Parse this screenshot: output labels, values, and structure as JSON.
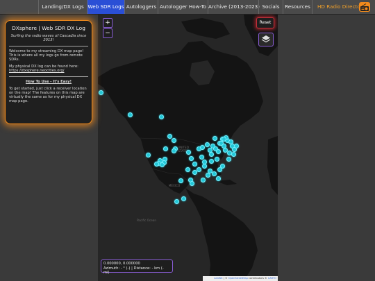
{
  "nav": {
    "items": [
      {
        "label": "Landing/DX Logs"
      },
      {
        "label": "Web SDR Logs"
      },
      {
        "label": "Autologgers"
      },
      {
        "label": "Autologger How-To"
      },
      {
        "label": "Archive (2013-2023)"
      },
      {
        "label": "Socials"
      },
      {
        "label": "Resources"
      },
      {
        "label": "HD Radio Directory"
      }
    ],
    "active_index": 1,
    "radio_icon": "radio-icon",
    "accent": "#2a4fd6",
    "orange": "#f08a1c"
  },
  "panel": {
    "title": "DXsphere | Web SDR DX Log",
    "subtitle": "Surfing the radio waves of Cascadia since 2013!",
    "welcome": "Welcome to my streaming DX map page! This is where all my logs go from remote SDRs.",
    "physical": "My physical DX log can be found here:",
    "link": "https://dxsphere.neocities.org/",
    "howto_title": "How To Use - It's Easy!",
    "howto_text": "To get started, just click a receiver location on the map! The features on this map are virtually the same as for my physical DX map page."
  },
  "map": {
    "zoom_in": "+",
    "zoom_out": "−",
    "reset": "Reset",
    "layers_icon": "layers-icon",
    "coords_line1": "0.000000, 0.000000",
    "coords_line2": "Azimuth: - ° (-) | Distance: - km (- mi)",
    "attribution_leaflet": "Leaflet",
    "attribution_sep": " | © ",
    "attribution_osm": "OpenStreetMap",
    "attribution_contrib": " contributors © ",
    "attribution_carto": "CARTO",
    "labels": {
      "us": "UNITED STATES",
      "mexico": "MÉXICO",
      "pacific": "Pacific Ocean"
    },
    "marker_color": "#22c8d8",
    "marker_count": 62
  }
}
